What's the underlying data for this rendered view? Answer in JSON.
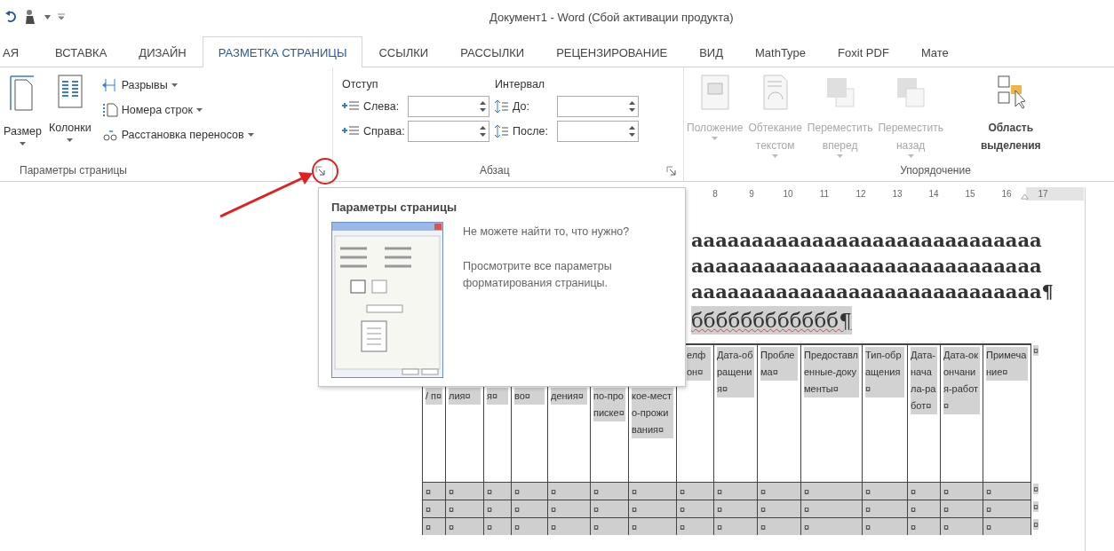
{
  "window": {
    "title": "Документ1 - Word (Сбой активации продукта)"
  },
  "tabs": [
    {
      "label": "АЯ",
      "selected": false
    },
    {
      "label": "ВСТАВКА",
      "selected": false
    },
    {
      "label": "ДИЗАЙН",
      "selected": false
    },
    {
      "label": "РАЗМЕТКА СТРАНИЦЫ",
      "selected": true
    },
    {
      "label": "ССЫЛКИ",
      "selected": false
    },
    {
      "label": "РАССЫЛКИ",
      "selected": false
    },
    {
      "label": "РЕЦЕНЗИРОВАНИЕ",
      "selected": false
    },
    {
      "label": "ВИД",
      "selected": false
    },
    {
      "label": "MathType",
      "selected": false
    },
    {
      "label": "Foxit PDF",
      "selected": false
    },
    {
      "label": "Мате",
      "selected": false
    }
  ],
  "ribbon_groups": [
    {
      "kind": "page_setup",
      "label": "Параметры страницы",
      "large_buttons": [
        {
          "label": "Размер"
        },
        {
          "label": "Колонки"
        }
      ],
      "small_buttons": [
        {
          "label": "Разрывы"
        },
        {
          "label": "Номера строк"
        },
        {
          "label": "Расстановка переносов"
        }
      ]
    },
    {
      "kind": "paragraph",
      "label": "Абзац",
      "sections": [
        {
          "heading": "Отступ",
          "fields": [
            {
              "label": "Слева:"
            },
            {
              "label": "Справа:"
            }
          ]
        },
        {
          "heading": "Интервал",
          "fields": [
            {
              "label": "До:"
            },
            {
              "label": "После:"
            }
          ]
        }
      ]
    },
    {
      "kind": "arrange",
      "label": "Упорядочение",
      "buttons": [
        {
          "lines": [
            "Положение"
          ],
          "dropdown": true,
          "disabled": true
        },
        {
          "lines": [
            "Обтекание",
            "текстом"
          ],
          "dropdown": true,
          "disabled": true
        },
        {
          "lines": [
            "Переместить",
            "вперед"
          ],
          "dropdown": true,
          "disabled": true
        },
        {
          "lines": [
            "Переместить",
            "назад"
          ],
          "dropdown": true,
          "disabled": true
        },
        {
          "lines": [
            "Область",
            "выделения"
          ],
          "dropdown": false,
          "disabled": false
        }
      ]
    }
  ],
  "tooltip": {
    "title": "Параметры страницы",
    "paragraphs": [
      "Не можете найти то, что нужно?",
      "Просмотрите все параметры форматирования страницы."
    ]
  },
  "ruler": {
    "numbers": [
      "8",
      "9",
      "10",
      "11",
      "12",
      "13",
      "14",
      "15",
      "16",
      "17"
    ]
  },
  "document": {
    "lines": [
      "ааааааааааааааааааааааааааааа",
      "ааааааааааааааааааааааааааааа",
      "ааааааааааааааааааааааааааааа¶"
    ],
    "highlighted_line": "бббббббббббб¶"
  },
  "table": {
    "header": {
      "cells": [
        "/ п¤",
        "лия¤",
        "я¤",
        "во¤",
        "дения¤",
        "по-прописке¤",
        "кое-место-проживания¤",
        "елфон¤",
        "Дата-обращения¤",
        "Проблема¤",
        "Предоставленные-документы¤",
        "Тип-обращения¤",
        "Дата-начала-работ¤",
        "Дата-окончания-работ¤",
        "Примечание¤"
      ],
      "end": "¤"
    },
    "rows": [
      {
        "cells": [
          "¤",
          "¤",
          "¤",
          "¤",
          "¤",
          "¤",
          "¤",
          "¤",
          "¤",
          "¤",
          "¤",
          "¤",
          "¤",
          "¤",
          "¤"
        ],
        "end": "¤"
      },
      {
        "cells": [
          "¤",
          "¤",
          "¤",
          "¤",
          "¤",
          "¤",
          "¤",
          "¤",
          "¤",
          "¤",
          "¤",
          "¤",
          "¤",
          "¤",
          "¤"
        ],
        "end": "¤"
      },
      {
        "cells": [
          "¤",
          "¤",
          "¤",
          "¤",
          "¤",
          "¤",
          "¤",
          "¤",
          "¤",
          "¤",
          "¤",
          "¤",
          "¤",
          "¤",
          "¤"
        ],
        "end": "¤"
      }
    ]
  }
}
